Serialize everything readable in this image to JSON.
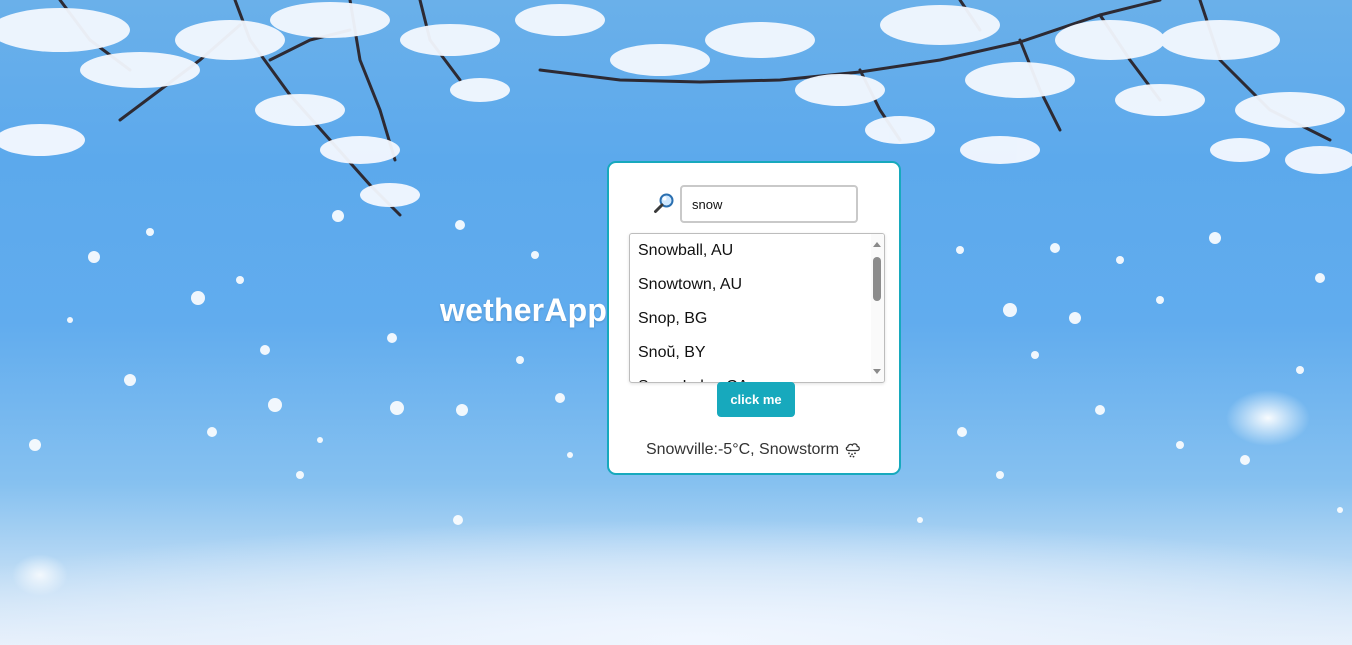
{
  "app": {
    "title": "wetherApp"
  },
  "search": {
    "value": "snow",
    "icon": "magnifier-icon"
  },
  "suggestions": [
    {
      "label": "Snowball, AU"
    },
    {
      "label": "Snowtown, AU"
    },
    {
      "label": "Snop, BG"
    },
    {
      "label": "Snoŭ, BY"
    },
    {
      "label": "Snow Lake, CA"
    }
  ],
  "button": {
    "label": "click me"
  },
  "result": {
    "text": "Snowville:-5°C, Snowstorm",
    "icon": "cloud-snow-icon"
  },
  "colors": {
    "accent": "#17a9bd",
    "sky": "#5ca9ec",
    "text": "#333333"
  }
}
